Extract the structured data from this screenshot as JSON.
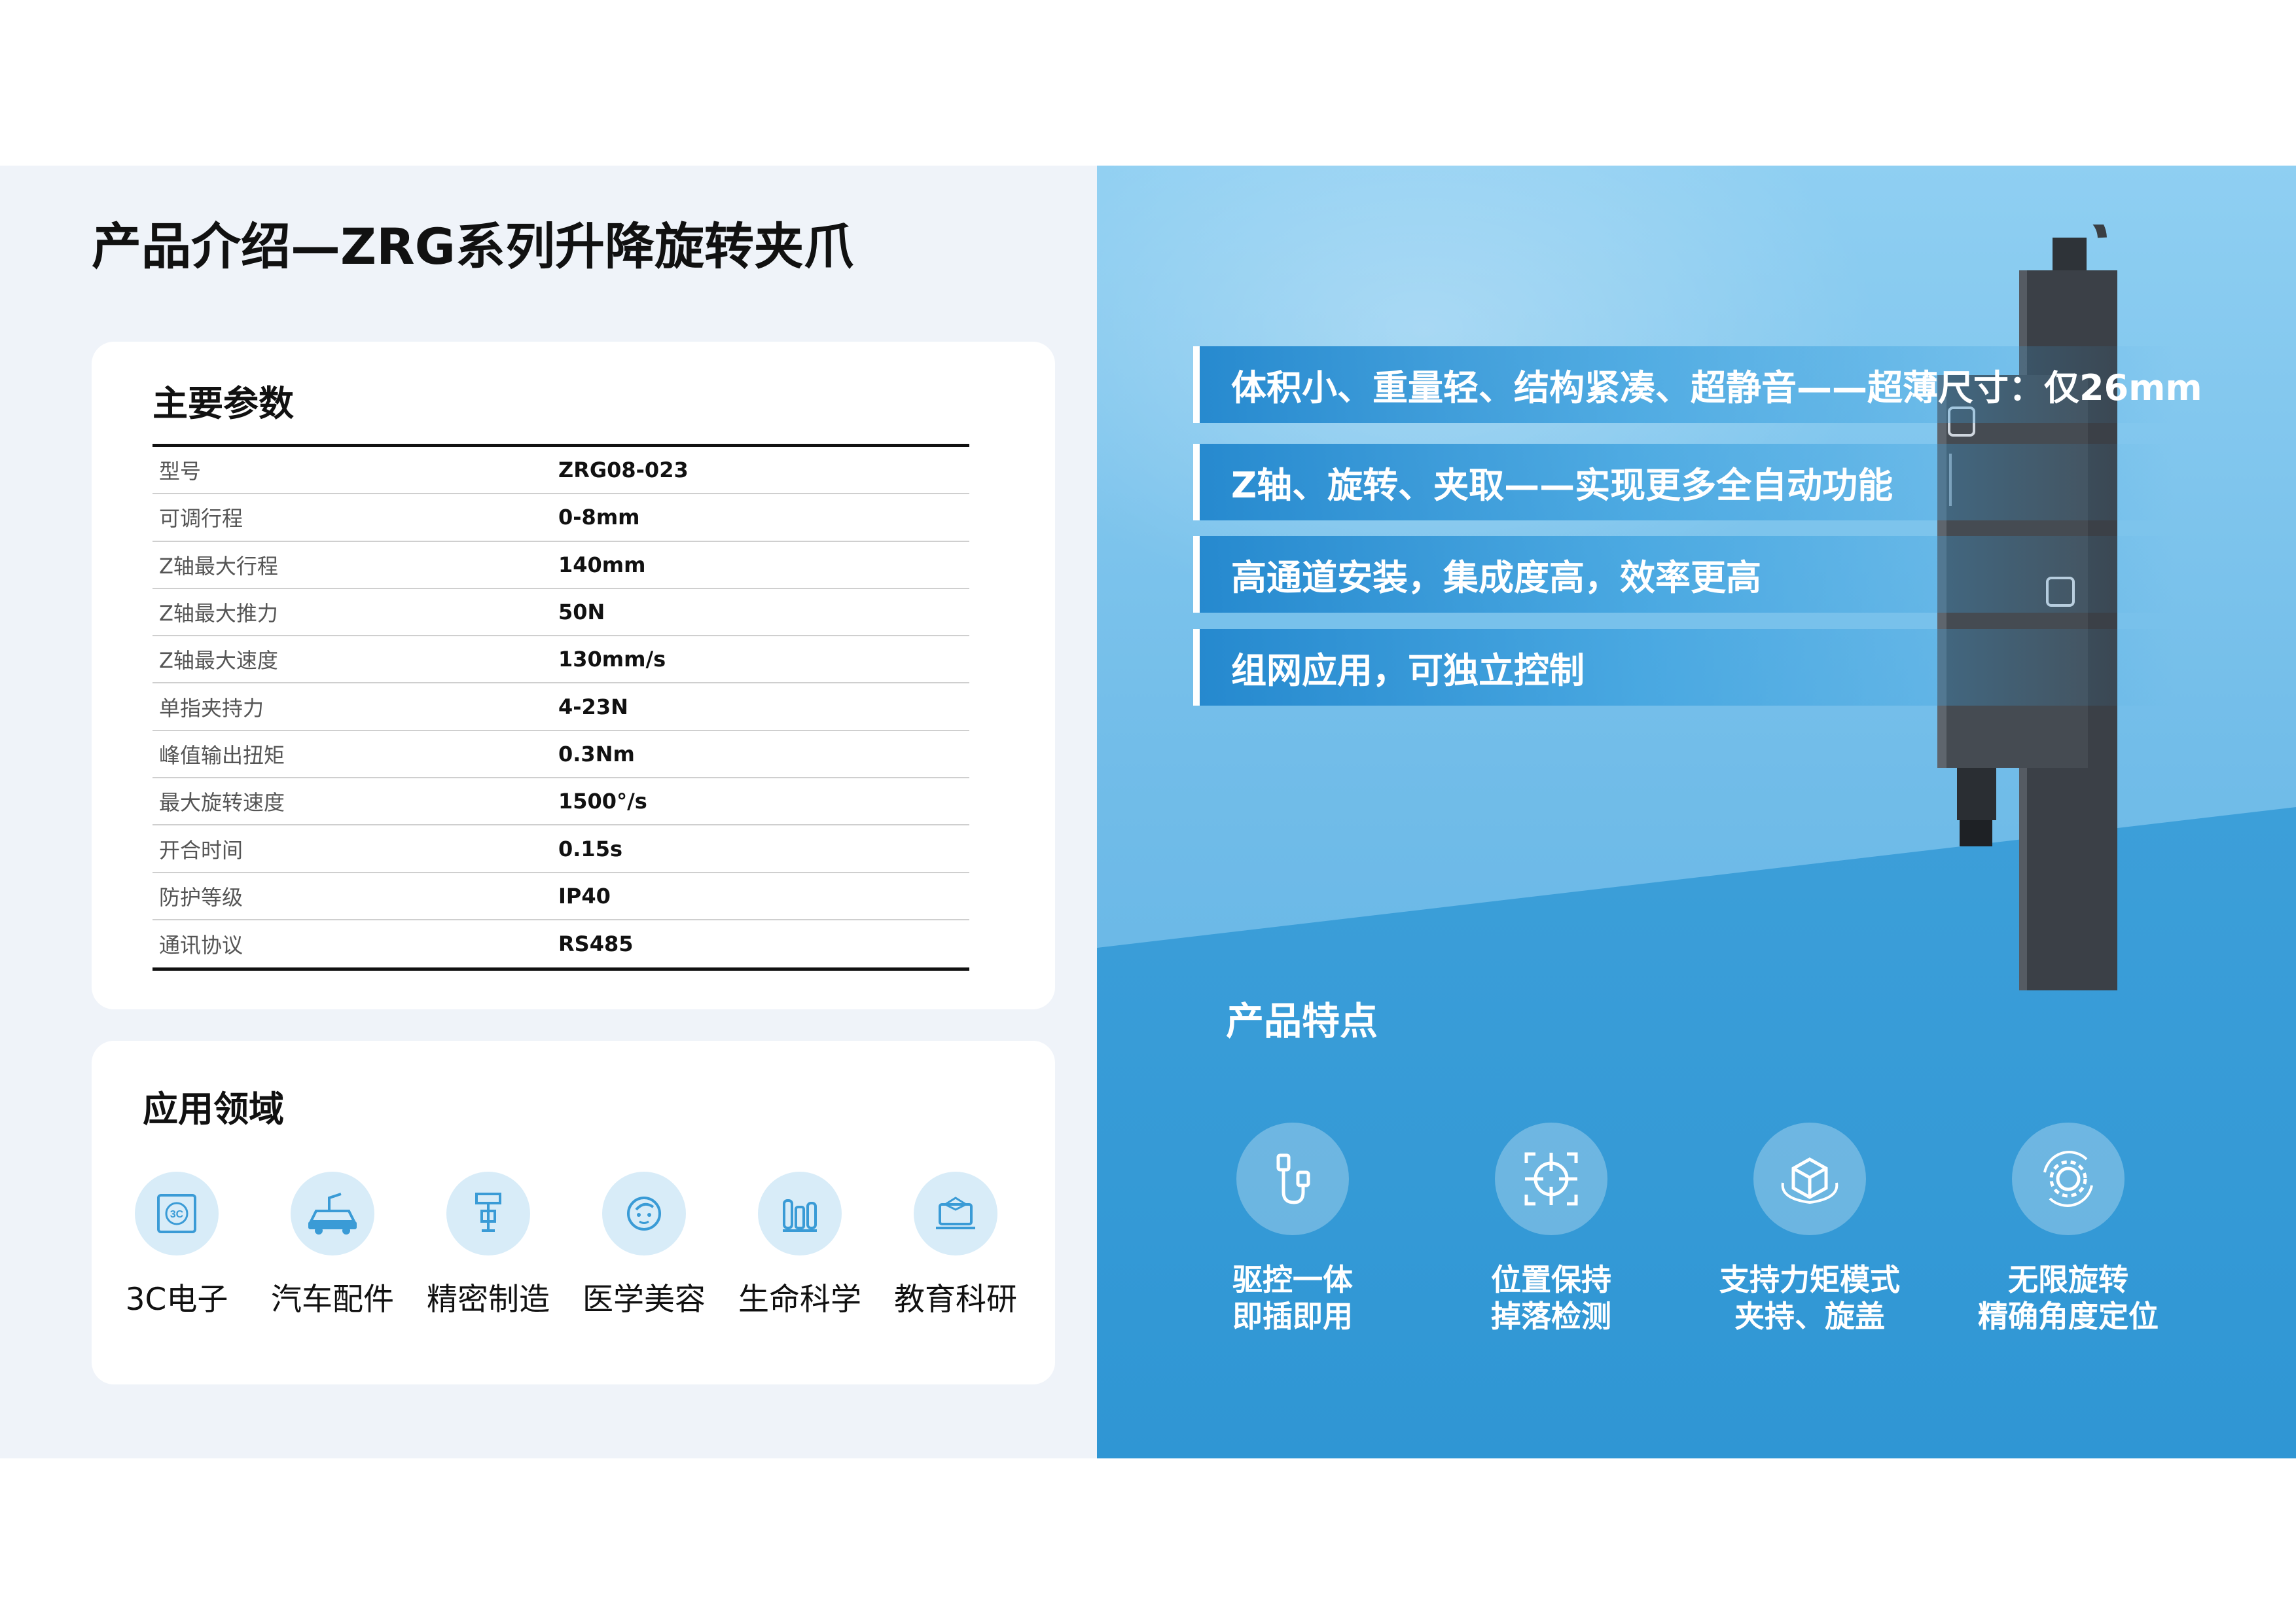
{
  "title": "产品介绍—ZRG系列升降旋转夹爪",
  "specs": {
    "heading": "主要参数",
    "rows": [
      {
        "label": "型号",
        "value": "ZRG08-023"
      },
      {
        "label": "可调行程",
        "value": "0-8mm"
      },
      {
        "label": "Z轴最大行程",
        "value": "140mm"
      },
      {
        "label": "Z轴最大推力",
        "value": "50N"
      },
      {
        "label": "Z轴最大速度",
        "value": "130mm/s"
      },
      {
        "label": "单指夹持力",
        "value": "4-23N"
      },
      {
        "label": "峰值输出扭矩",
        "value": "0.3Nm"
      },
      {
        "label": "最大旋转速度",
        "value": "1500°/s"
      },
      {
        "label": "开合时间",
        "value": "0.15s"
      },
      {
        "label": "防护等级",
        "value": "IP40"
      },
      {
        "label": "通讯协议",
        "value": "RS485"
      }
    ]
  },
  "applications": {
    "heading": "应用领域",
    "items": [
      {
        "label": "3C电子",
        "icon": "chip-icon",
        "badge": "3C"
      },
      {
        "label": "汽车配件",
        "icon": "car-icon"
      },
      {
        "label": "精密制造",
        "icon": "precision-tool-icon"
      },
      {
        "label": "医学美容",
        "icon": "face-care-icon"
      },
      {
        "label": "生命科学",
        "icon": "test-tube-icon"
      },
      {
        "label": "教育科研",
        "icon": "graduation-laptop-icon"
      }
    ]
  },
  "highlights": [
    "体积小、重量轻、结构紧凑、超静音——超薄尺寸：仅26mm",
    "Z轴、旋转、夹取——实现更多全自动功能",
    "高通道安装，集成度高，效率更高",
    "组网应用，可独立控制"
  ],
  "features": {
    "heading": "产品特点",
    "items": [
      {
        "line1": "驱控一体",
        "line2": "即插即用",
        "icon": "plug-cable-icon"
      },
      {
        "line1": "位置保持",
        "line2": "掉落检测",
        "icon": "target-crosshair-icon"
      },
      {
        "line1": "支持力矩模式",
        "line2": "夹持、旋盖",
        "icon": "box-rotate-icon"
      },
      {
        "line1": "无限旋转",
        "line2": "精确角度定位",
        "icon": "gear-rotate-icon"
      }
    ]
  },
  "colors": {
    "accent_blue": "#2f96d4",
    "light_blue": "#8fcff2",
    "icon_blue": "#3a9bd6",
    "panel_bg": "#eff3f9"
  }
}
